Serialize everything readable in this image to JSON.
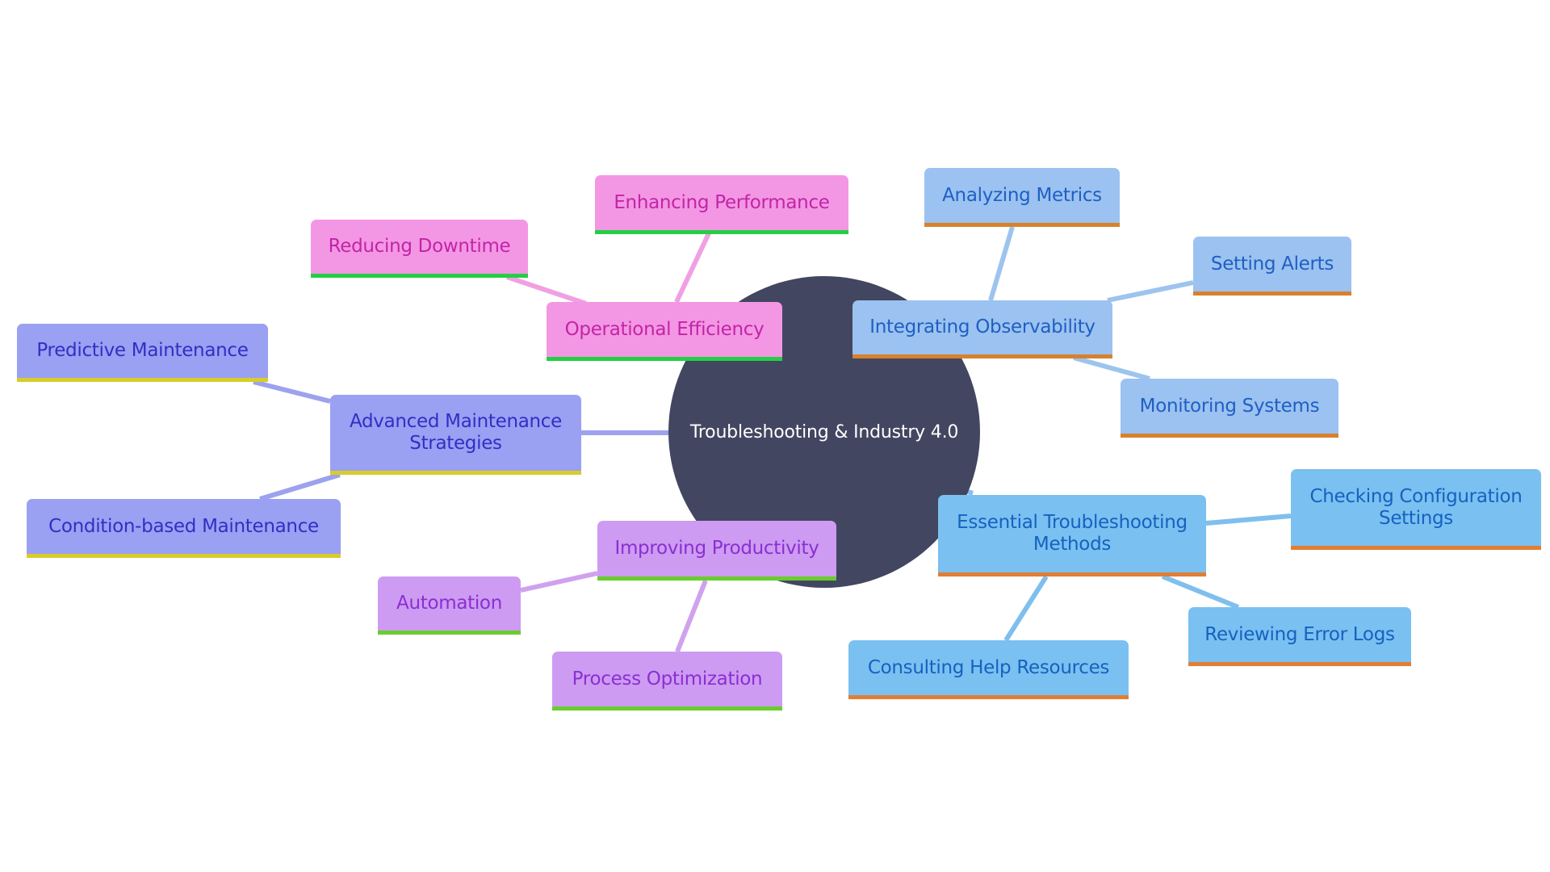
{
  "diagram": {
    "type": "mindmap",
    "root": {
      "id": "root",
      "label": "Troubleshooting & Industry 4.0",
      "color": "#424660"
    },
    "branches": [
      {
        "id": "operational-efficiency",
        "label": "Operational Efficiency",
        "style": "pink",
        "fill": "#f397e4",
        "text_color": "#c324a6",
        "underline": "#24cf44",
        "children": [
          {
            "id": "reducing-downtime",
            "label": "Reducing Downtime"
          },
          {
            "id": "enhancing-performance",
            "label": "Enhancing Performance"
          }
        ]
      },
      {
        "id": "integrating-observability",
        "label": "Integrating Observability",
        "style": "lblue",
        "fill": "#9bc2f0",
        "text_color": "#1f5fc4",
        "underline": "#d8812c",
        "children": [
          {
            "id": "analyzing-metrics",
            "label": "Analyzing Metrics"
          },
          {
            "id": "setting-alerts",
            "label": "Setting Alerts"
          },
          {
            "id": "monitoring-systems",
            "label": "Monitoring Systems"
          }
        ]
      },
      {
        "id": "advanced-maintenance",
        "label": "Advanced Maintenance Strategies",
        "style": "violet",
        "fill": "#9aa0f2",
        "text_color": "#2f30c4",
        "underline": "#d8cd2a",
        "children": [
          {
            "id": "predictive-maintenance",
            "label": "Predictive Maintenance"
          },
          {
            "id": "condition-based-maintenance",
            "label": "Condition-based Maintenance"
          }
        ]
      },
      {
        "id": "improving-productivity",
        "label": "Improving Productivity",
        "style": "purple",
        "fill": "#cd9bf2",
        "text_color": "#8a2fd2",
        "underline": "#6acd2c",
        "children": [
          {
            "id": "automation",
            "label": "Automation"
          },
          {
            "id": "process-optimization",
            "label": "Process Optimization"
          }
        ]
      },
      {
        "id": "essential-troubleshooting",
        "label": "Essential Troubleshooting Methods",
        "style": "sblue",
        "fill": "#7ac0f1",
        "text_color": "#1562bf",
        "underline": "#e17e34",
        "children": [
          {
            "id": "checking-configuration",
            "label": "Checking Configuration Settings"
          },
          {
            "id": "reviewing-error-logs",
            "label": "Reviewing Error Logs"
          },
          {
            "id": "consulting-help",
            "label": "Consulting Help Resources"
          }
        ]
      }
    ],
    "edge_colors": {
      "pink": "#f0a0e2",
      "lblue": "#9dc4ee",
      "violet": "#9ca2ee",
      "purple": "#cfa2ee",
      "sblue": "#7fbfee"
    }
  }
}
